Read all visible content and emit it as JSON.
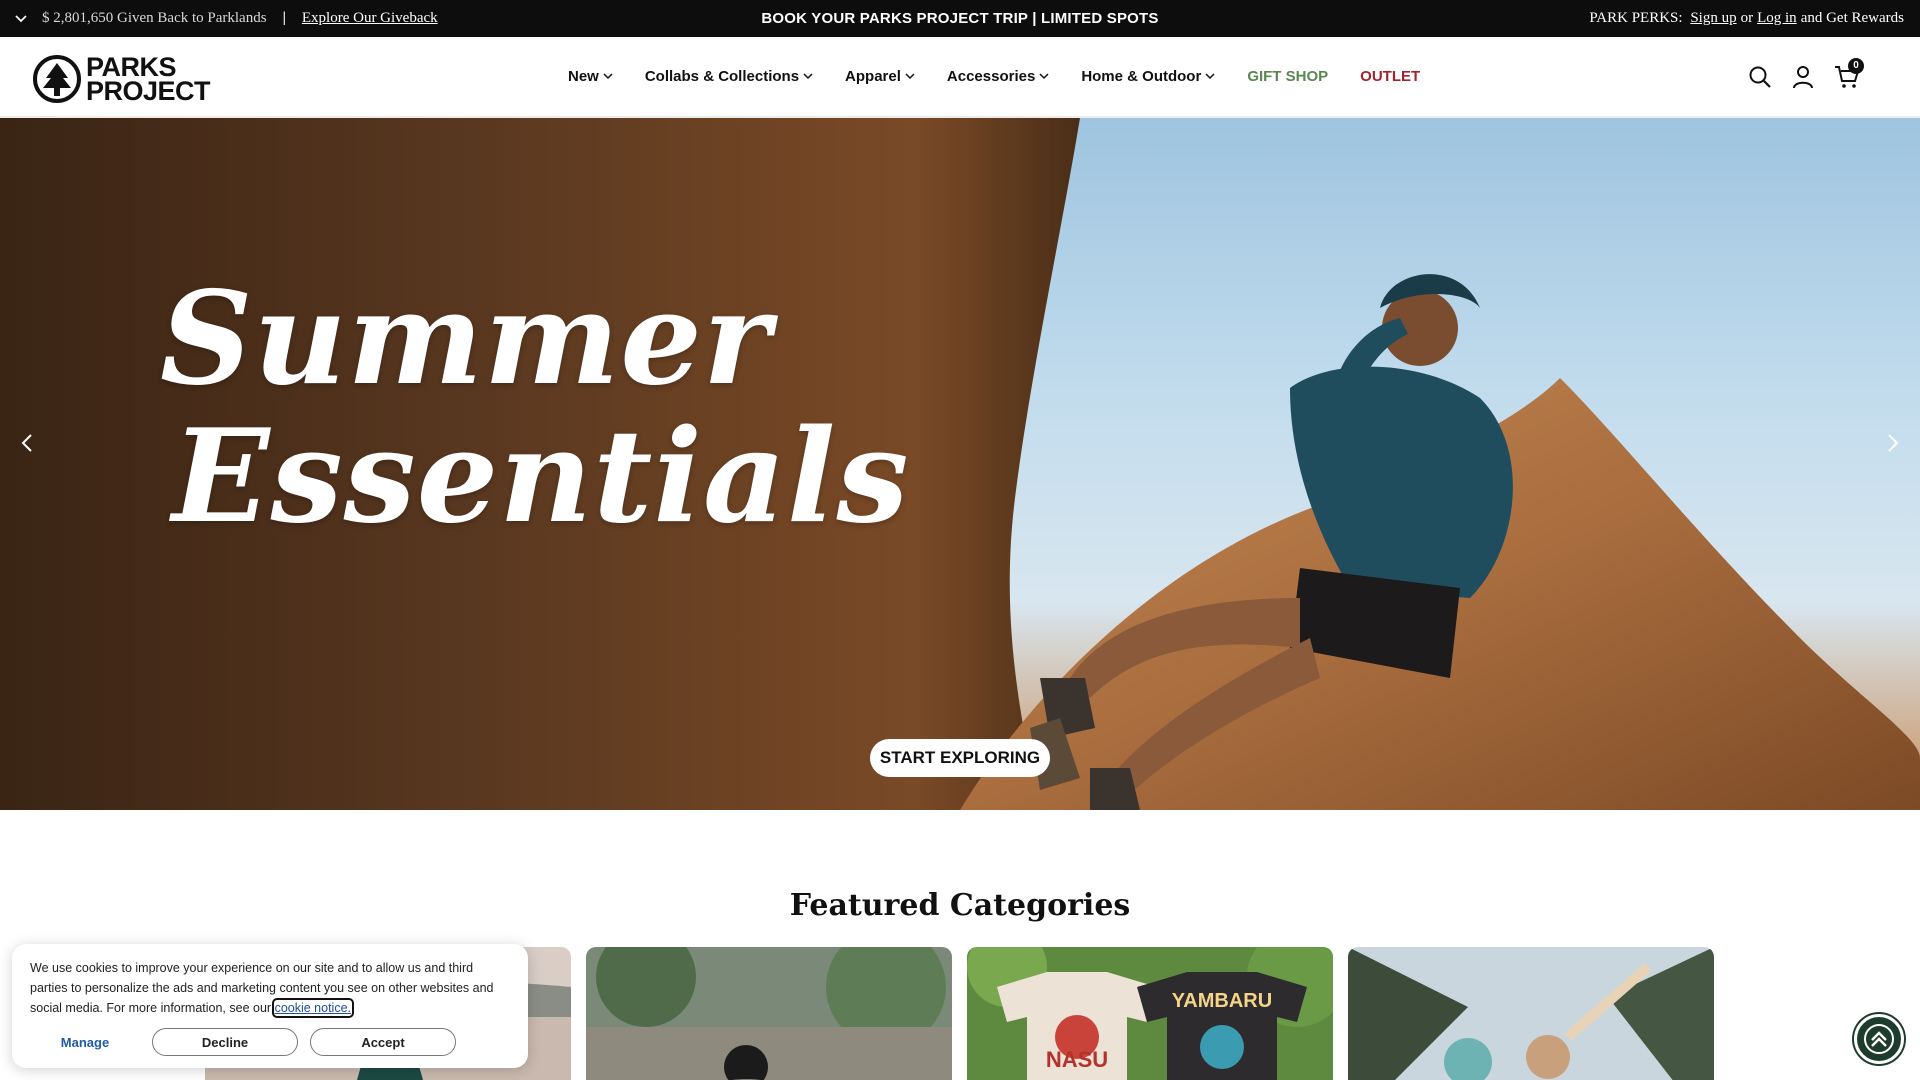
{
  "announcement": {
    "giveback_text": "$ 2,801,650 Given Back to Parklands",
    "separator": "|",
    "giveback_link": "Explore Our Giveback",
    "center_text": "BOOK YOUR PARKS PROJECT TRIP | LIMITED SPOTS",
    "perks_prefix": "PARK PERKS:",
    "signup_link": "Sign up",
    "or_text": "or",
    "login_link": "Log in",
    "perks_suffix": "and Get Rewards"
  },
  "header": {
    "logo_line1": "PARKS",
    "logo_line2": "PROJECT",
    "nav": [
      {
        "label": "New",
        "dropdown": true
      },
      {
        "label": "Collabs & Collections",
        "dropdown": true
      },
      {
        "label": "Apparel",
        "dropdown": true
      },
      {
        "label": "Accessories",
        "dropdown": true
      },
      {
        "label": "Home & Outdoor",
        "dropdown": true
      },
      {
        "label": "GIFT SHOP",
        "dropdown": false
      },
      {
        "label": "OUTLET",
        "dropdown": false
      }
    ],
    "cart_count": "0",
    "icons": [
      "search-icon",
      "account-icon",
      "cart-icon"
    ]
  },
  "hero": {
    "title_line1": "Summer",
    "title_line2": "Essentials",
    "cta_label": "START EXPLORING"
  },
  "featured": {
    "title": "Featured Categories",
    "card_tshirt_left": "NASU",
    "card_tshirt_right": "YAMBARU"
  },
  "cookie": {
    "text": "We use cookies to improve your experience on our site and to allow us and third parties to personalize the ads and marketing content you see on other websites and social media. For more information, see our",
    "link": "cookie notice.",
    "manage": "Manage",
    "decline": "Decline",
    "accept": "Accept"
  },
  "colors": {
    "gift_shop": "#5a8650",
    "outlet": "#a3232d",
    "announcement_bg": "#0d0d0d",
    "a11y_bg": "#1d3c2e"
  }
}
